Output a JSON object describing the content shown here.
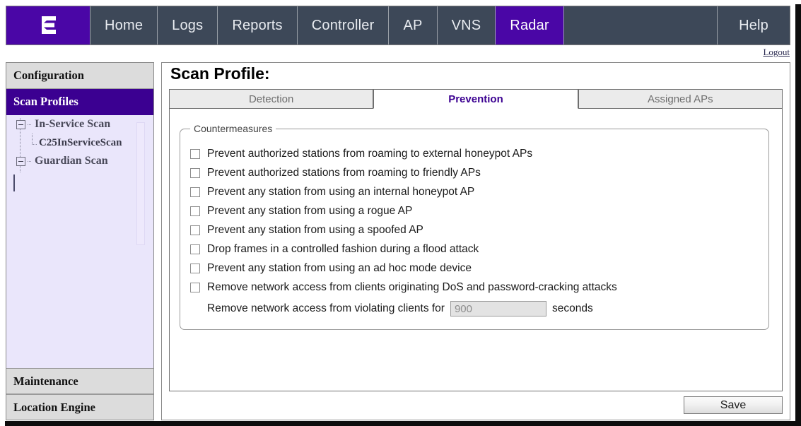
{
  "topnav": {
    "logo_icon": "extreme-networks-e-logo",
    "items": [
      {
        "label": "Home",
        "active": false
      },
      {
        "label": "Logs",
        "active": false
      },
      {
        "label": "Reports",
        "active": false
      },
      {
        "label": "Controller",
        "active": false
      },
      {
        "label": "AP",
        "active": false
      },
      {
        "label": "VNS",
        "active": false
      },
      {
        "label": "Radar",
        "active": true
      }
    ],
    "help_label": "Help",
    "logout_label": "Logout",
    "active_color": "#4a06a6",
    "bar_color": "#3d4858"
  },
  "sidebar": {
    "configuration_label": "Configuration",
    "scan_profiles_label": "Scan Profiles",
    "scan_profiles_selected_color": "#3b0091",
    "tree": [
      {
        "label": "In-Service Scan",
        "level": 0,
        "expanded": true
      },
      {
        "label": "C25InServiceScan",
        "level": 1,
        "expanded": false
      },
      {
        "label": "Guardian Scan",
        "level": 0,
        "expanded": true
      }
    ],
    "maintenance_label": "Maintenance",
    "location_engine_label": "Location Engine"
  },
  "main": {
    "page_title": "Scan Profile:",
    "tabs": [
      {
        "label": "Detection",
        "active": false
      },
      {
        "label": "Prevention",
        "active": true
      },
      {
        "label": "Assigned APs",
        "active": false
      }
    ],
    "active_tab_color": "#3b0091",
    "countermeasures": {
      "legend": "Countermeasures",
      "options": [
        {
          "label": "Prevent authorized stations from roaming to external honeypot APs",
          "checked": false
        },
        {
          "label": "Prevent authorized stations from roaming to friendly APs",
          "checked": false
        },
        {
          "label": "Prevent any station from using an internal honeypot AP",
          "checked": false
        },
        {
          "label": "Prevent any station from using a rogue AP",
          "checked": false
        },
        {
          "label": "Prevent any station from using a spoofed AP",
          "checked": false
        },
        {
          "label": "Drop frames in a controlled fashion during a flood attack",
          "checked": false
        },
        {
          "label": "Prevent any station from using an ad hoc mode device",
          "checked": false
        },
        {
          "label": "Remove network access from clients originating DoS and password-cracking attacks",
          "checked": false
        }
      ],
      "timeout_label": "Remove network access from violating clients for",
      "timeout_value": "900",
      "timeout_units": "seconds",
      "timeout_disabled": true
    },
    "save_label": "Save"
  }
}
